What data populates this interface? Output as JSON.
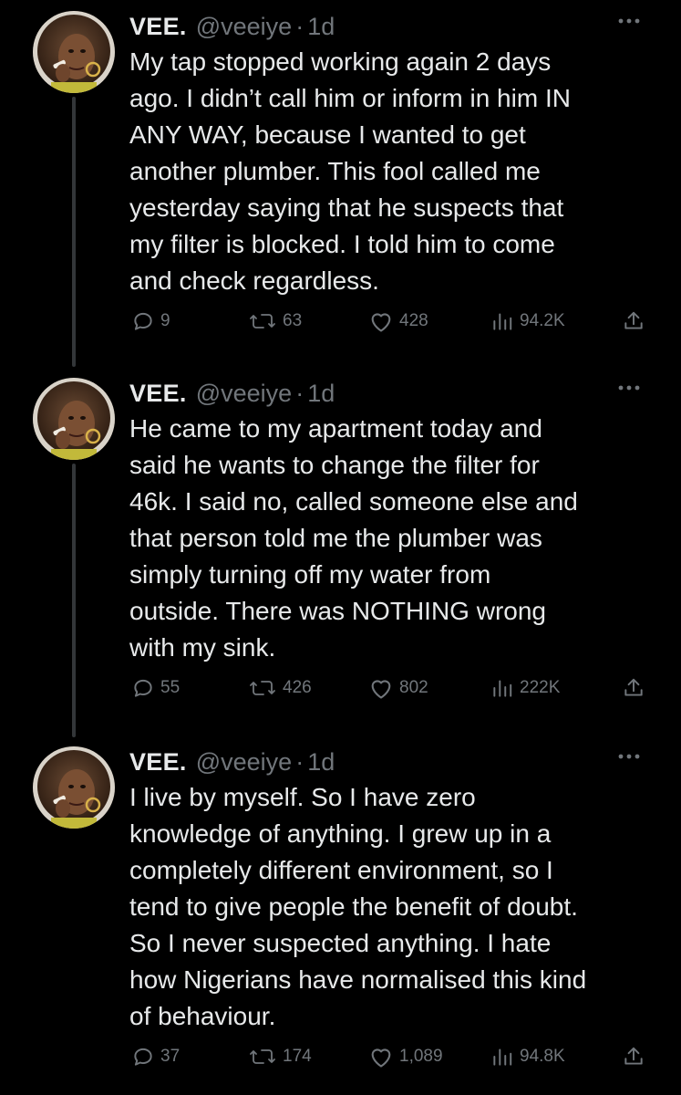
{
  "colors": {
    "background": "#000000",
    "text": "#e7e9ea",
    "secondary": "#71767b",
    "thread_line": "#333639"
  },
  "tweets": [
    {
      "author_name": "VEE.",
      "handle": "@veeiye",
      "separator": "·",
      "time": "1d",
      "body": "My tap stopped working again 2 days\nago. I didn’t call him or inform in him IN\nANY WAY, because I wanted to get\nanother plumber. This fool called me\nyesterday saying that he suspects that\nmy filter is blocked. I told him to come\nand check regardless.",
      "replies": "9",
      "retweets": "63",
      "likes": "428",
      "views": "94.2K"
    },
    {
      "author_name": "VEE.",
      "handle": "@veeiye",
      "separator": "·",
      "time": "1d",
      "body": "He came to my apartment today and\nsaid he wants to change the filter for\n46k. I said no, called someone else and\nthat person told me the plumber was\nsimply turning off my water from\noutside. There was NOTHING wrong\nwith my sink.",
      "replies": "55",
      "retweets": "426",
      "likes": "802",
      "views": "222K"
    },
    {
      "author_name": "VEE.",
      "handle": "@veeiye",
      "separator": "·",
      "time": "1d",
      "body": "I live by myself. So I have zero\nknowledge of anything. I grew up in a\ncompletely different environment, so I\ntend to give people the benefit of doubt.\nSo I never suspected anything. I hate\nhow Nigerians have normalised this kind\nof behaviour.",
      "replies": "37",
      "retweets": "174",
      "likes": "1,089",
      "views": "94.8K"
    }
  ],
  "icons": {
    "more": "more-horizontal-icon",
    "reply": "reply-bubble-icon",
    "retweet": "retweet-icon",
    "like": "heart-icon",
    "views": "views-bars-icon",
    "share": "share-upload-icon",
    "avatar": "profile-photo"
  }
}
